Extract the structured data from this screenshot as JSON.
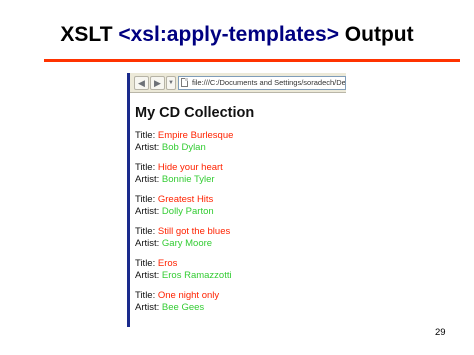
{
  "slide": {
    "title_prefix": "XSLT ",
    "title_tag": "<xsl:apply-templates>",
    "title_suffix": " Output",
    "page_number": "29",
    "accent_color": "#ff3300"
  },
  "browser": {
    "address": "file:///C:/Documents and Settings/soradech/Desktop/c",
    "back_icon": "back-arrow-icon",
    "forward_icon": "forward-arrow-icon"
  },
  "page": {
    "heading": "My CD Collection",
    "title_label": "Title: ",
    "artist_label": "Artist: ",
    "title_color": "#ff2200",
    "artist_color": "#33cc33",
    "cds": [
      {
        "title": "Empire Burlesque",
        "artist": "Bob Dylan"
      },
      {
        "title": "Hide your heart",
        "artist": "Bonnie Tyler"
      },
      {
        "title": "Greatest Hits",
        "artist": "Dolly Parton"
      },
      {
        "title": "Still got the blues",
        "artist": "Gary Moore"
      },
      {
        "title": "Eros",
        "artist": "Eros Ramazzotti"
      },
      {
        "title": "One night only",
        "artist": "Bee Gees"
      }
    ]
  }
}
